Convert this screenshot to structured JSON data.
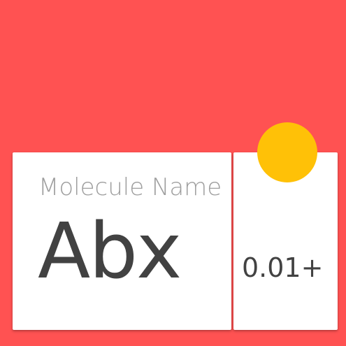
{
  "colors": {
    "background": "#ff5252",
    "card": "#ffffff",
    "accent_fab": "#ffc107",
    "label_text": "#9e9e9e",
    "value_text": "#424242"
  },
  "main_card": {
    "label": "Molecule Name",
    "value": "Abx"
  },
  "side_card": {
    "value": "0.01+"
  },
  "fab": {
    "icon": "yellow-circle-icon"
  }
}
